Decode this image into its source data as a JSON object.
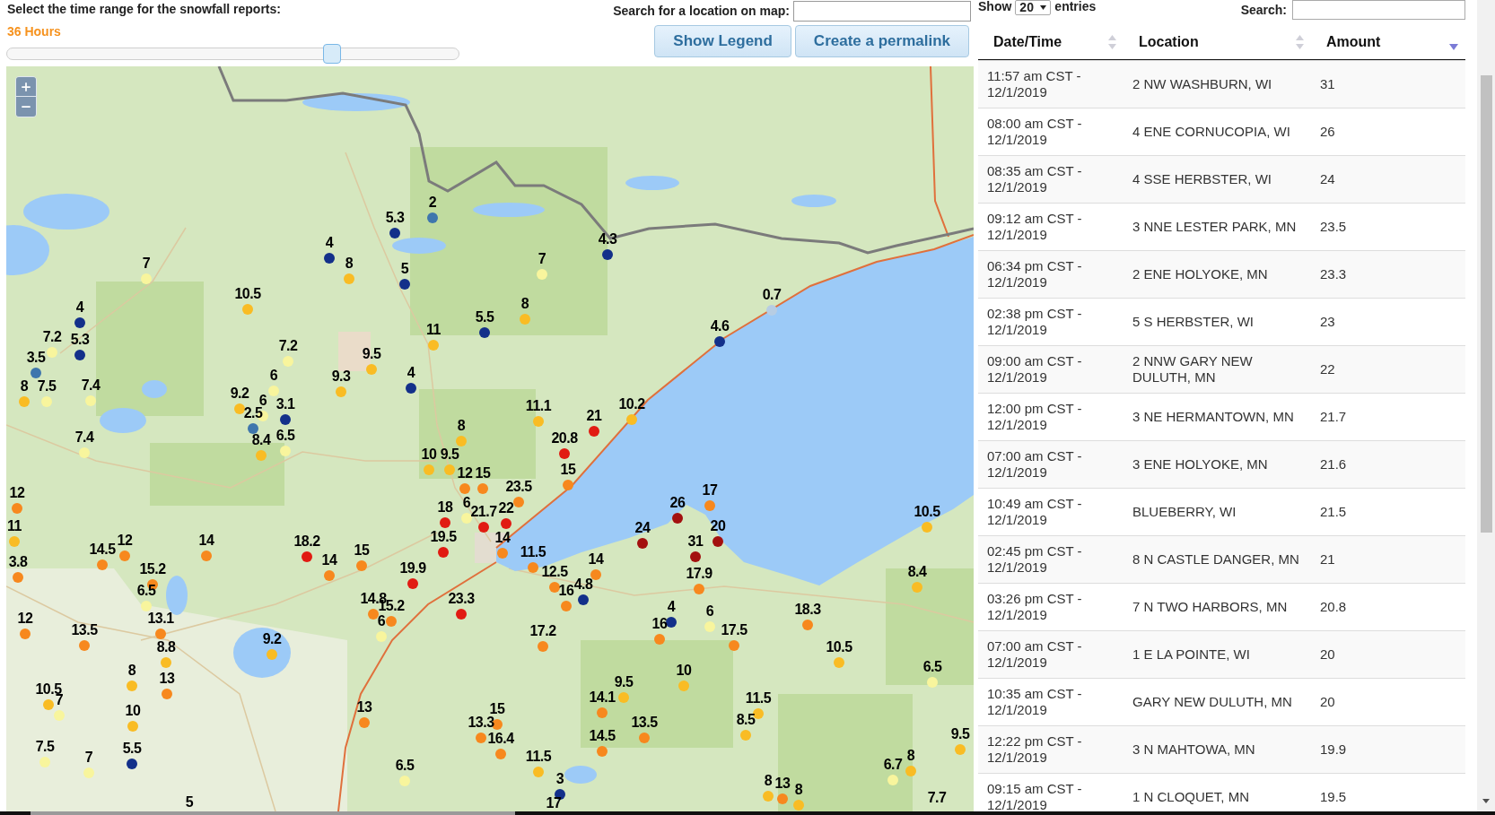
{
  "time_range": {
    "label": "Select the time range for the snowfall reports:",
    "value": "36 Hours",
    "level": 0.72
  },
  "map_search": {
    "label": "Search for a location on map:"
  },
  "buttons": [
    {
      "label": "Show Legend"
    },
    {
      "label": "Create a permalink"
    }
  ],
  "map": {
    "markers": [
      {
        "value": "2",
        "color": "#3f76ad"
      },
      {
        "value": "5.3",
        "color": "#13308a"
      },
      {
        "value": "4",
        "color": "#13308a"
      },
      {
        "value": "4.3",
        "color": "#13308a"
      },
      {
        "value": "7",
        "color": "#f8f59d"
      },
      {
        "value": "8",
        "color": "#f9bc24"
      },
      {
        "value": "5",
        "color": "#13308a"
      },
      {
        "value": "7",
        "color": "#f8f59d"
      },
      {
        "value": "10.5",
        "color": "#f9bc24"
      },
      {
        "value": "0.7",
        "color": "#b7cde3"
      },
      {
        "value": "4",
        "color": "#13308a"
      },
      {
        "value": "8",
        "color": "#f9bc24"
      },
      {
        "value": "5.5",
        "color": "#13308a"
      },
      {
        "value": "11",
        "color": "#f9bc24"
      },
      {
        "value": "4.6",
        "color": "#13308a"
      },
      {
        "value": "7.2",
        "color": "#f8f59d"
      },
      {
        "value": "5.3",
        "color": "#13308a"
      },
      {
        "value": "7.2",
        "color": "#f8f59d"
      },
      {
        "value": "3.5",
        "color": "#3f76ad"
      },
      {
        "value": "9.5",
        "color": "#f9bc24"
      },
      {
        "value": "6",
        "color": "#f8f59d"
      },
      {
        "value": "9.3",
        "color": "#f9bc24"
      },
      {
        "value": "4",
        "color": "#13308a"
      },
      {
        "value": "8",
        "color": "#f9bc24"
      },
      {
        "value": "7.5",
        "color": "#f8f59d"
      },
      {
        "value": "7.4",
        "color": "#f8f59d"
      },
      {
        "value": "9.2",
        "color": "#f9bc24"
      },
      {
        "value": "6",
        "color": "#f8f59d"
      },
      {
        "value": "3.1",
        "color": "#13308a"
      },
      {
        "value": "11.1",
        "color": "#f9bc24"
      },
      {
        "value": "10.2",
        "color": "#f9bc24"
      },
      {
        "value": "2.5",
        "color": "#3f76ad"
      },
      {
        "value": "21",
        "color": "#e11b12"
      },
      {
        "value": "8",
        "color": "#f9bc24"
      },
      {
        "value": "7.4",
        "color": "#f8f59d"
      },
      {
        "value": "8.4",
        "color": "#f9bc24"
      },
      {
        "value": "6.5",
        "color": "#f8f59d"
      },
      {
        "value": "20.8",
        "color": "#e11b12"
      },
      {
        "value": "10",
        "color": "#f9bc24"
      },
      {
        "value": "9.5",
        "color": "#f9bc24"
      },
      {
        "value": "12",
        "color": "#f7881e"
      },
      {
        "value": "15",
        "color": "#f7881e"
      },
      {
        "value": "15",
        "color": "#f7881e"
      },
      {
        "value": "12",
        "color": "#f7881e"
      },
      {
        "value": "23.5",
        "color": "#f7881e"
      },
      {
        "value": "17",
        "color": "#f7881e"
      },
      {
        "value": "18",
        "color": "#e11b12"
      },
      {
        "value": "6",
        "color": "#f8f59d"
      },
      {
        "value": "21.7",
        "color": "#e11b12"
      },
      {
        "value": "22",
        "color": "#e11b12"
      },
      {
        "value": "26",
        "color": "#a3100f"
      },
      {
        "value": "10.5",
        "color": "#f9bc24"
      },
      {
        "value": "11",
        "color": "#f9bc24"
      },
      {
        "value": "24",
        "color": "#a3100f"
      },
      {
        "value": "20",
        "color": "#a3100f"
      },
      {
        "value": "12",
        "color": "#f7881e"
      },
      {
        "value": "14",
        "color": "#f7881e"
      },
      {
        "value": "18.2",
        "color": "#e11b12"
      },
      {
        "value": "19.5",
        "color": "#e11b12"
      },
      {
        "value": "14",
        "color": "#f7881e"
      },
      {
        "value": "31",
        "color": "#a3100f"
      },
      {
        "value": "14.5",
        "color": "#f7881e"
      },
      {
        "value": "15",
        "color": "#f7881e"
      },
      {
        "value": "11.5",
        "color": "#f7881e"
      },
      {
        "value": "3.8",
        "color": "#f7881e"
      },
      {
        "value": "14",
        "color": "#f7881e"
      },
      {
        "value": "14",
        "color": "#f7881e"
      },
      {
        "value": "15.2",
        "color": "#f7881e"
      },
      {
        "value": "19.9",
        "color": "#e11b12"
      },
      {
        "value": "12.5",
        "color": "#f7881e"
      },
      {
        "value": "17.9",
        "color": "#f7881e"
      },
      {
        "value": "8.4",
        "color": "#f9bc24"
      },
      {
        "value": "4.8",
        "color": "#13308a"
      },
      {
        "value": "6.5",
        "color": "#f8f59d"
      },
      {
        "value": "16",
        "color": "#f7881e"
      },
      {
        "value": "14.8",
        "color": "#f7881e"
      },
      {
        "value": "23.3",
        "color": "#e11b12"
      },
      {
        "value": "15.2",
        "color": "#f7881e"
      },
      {
        "value": "4",
        "color": "#13308a"
      },
      {
        "value": "6",
        "color": "#f8f59d"
      },
      {
        "value": "18.3",
        "color": "#f7881e"
      },
      {
        "value": "12",
        "color": "#f7881e"
      },
      {
        "value": "13.1",
        "color": "#f7881e"
      },
      {
        "value": "6",
        "color": "#f8f59d"
      },
      {
        "value": "16",
        "color": "#f7881e"
      },
      {
        "value": "13.5",
        "color": "#f7881e"
      },
      {
        "value": "17.2",
        "color": "#f7881e"
      },
      {
        "value": "17.5",
        "color": "#f7881e"
      },
      {
        "value": "9.2",
        "color": "#f9bc24"
      },
      {
        "value": "8.8",
        "color": "#f9bc24"
      },
      {
        "value": "10.5",
        "color": "#f9bc24"
      },
      {
        "value": "8",
        "color": "#f9bc24"
      },
      {
        "value": "10",
        "color": "#f9bc24"
      },
      {
        "value": "6.5",
        "color": "#f8f59d"
      },
      {
        "value": "13",
        "color": "#f7881e"
      },
      {
        "value": "9.5",
        "color": "#f9bc24"
      },
      {
        "value": "10.5",
        "color": "#f9bc24"
      },
      {
        "value": "7",
        "color": "#f8f59d"
      },
      {
        "value": "14.1",
        "color": "#f7881e"
      },
      {
        "value": "11.5",
        "color": "#f9bc24"
      },
      {
        "value": "10",
        "color": "#f9bc24"
      },
      {
        "value": "13",
        "color": "#f7881e"
      },
      {
        "value": "15",
        "color": "#f7881e"
      },
      {
        "value": "13.3",
        "color": "#f7881e"
      },
      {
        "value": "13.5",
        "color": "#f7881e"
      },
      {
        "value": "8.5",
        "color": "#f9bc24"
      },
      {
        "value": "16.4",
        "color": "#f7881e"
      },
      {
        "value": "14.5",
        "color": "#f7881e"
      },
      {
        "value": "9.5",
        "color": "#f9bc24"
      },
      {
        "value": "7.5",
        "color": "#f8f59d"
      },
      {
        "value": "5.5",
        "color": "#13308a"
      },
      {
        "value": "7",
        "color": "#f8f59d"
      },
      {
        "value": "11.5",
        "color": "#f9bc24"
      },
      {
        "value": "8",
        "color": "#f9bc24"
      },
      {
        "value": "6.5",
        "color": "#f8f59d"
      },
      {
        "value": "6.7",
        "color": "#f8f59d"
      },
      {
        "value": "3",
        "color": "#13308a"
      },
      {
        "value": "8",
        "color": "#f9bc24"
      },
      {
        "value": "13",
        "color": "#f7881e"
      },
      {
        "value": "8",
        "color": "#f9bc24"
      },
      {
        "value": "5"
      },
      {
        "value": "17"
      },
      {
        "value": "7.7"
      }
    ]
  },
  "table": {
    "length_menu": {
      "label_before": "Show",
      "value": "20",
      "label_after": "entries"
    },
    "search": {
      "label": "Search:"
    },
    "columns": [
      {
        "label": "Date/Time",
        "sorted": false
      },
      {
        "label": "Location",
        "sorted": false
      },
      {
        "label": "Amount",
        "sorted": true
      }
    ],
    "rows": [
      {
        "date_time": "11:57 am CST - 12/1/2019",
        "location": "2 NW WASHBURN, WI",
        "amount": "31"
      },
      {
        "date_time": "08:00 am CST - 12/1/2019",
        "location": "4 ENE CORNUCOPIA, WI",
        "amount": "26"
      },
      {
        "date_time": "08:35 am CST - 12/1/2019",
        "location": "4 SSE HERBSTER, WI",
        "amount": "24"
      },
      {
        "date_time": "09:12 am CST - 12/1/2019",
        "location": "3 NNE LESTER PARK, MN",
        "amount": "23.5"
      },
      {
        "date_time": "06:34 pm CST - 12/1/2019",
        "location": "2 ENE HOLYOKE, MN",
        "amount": "23.3"
      },
      {
        "date_time": "02:38 pm CST - 12/1/2019",
        "location": "5 S HERBSTER, WI",
        "amount": "23"
      },
      {
        "date_time": "09:00 am CST - 12/1/2019",
        "location": "2 NNW GARY NEW DULUTH, MN",
        "amount": "22"
      },
      {
        "date_time": "12:00 pm CST - 12/1/2019",
        "location": "3 NE HERMANTOWN, MN",
        "amount": "21.7"
      },
      {
        "date_time": "07:00 am CST - 12/1/2019",
        "location": "3 ENE HOLYOKE, MN",
        "amount": "21.6"
      },
      {
        "date_time": "10:49 am CST - 12/1/2019",
        "location": "BLUEBERRY, WI",
        "amount": "21.5"
      },
      {
        "date_time": "02:45 pm CST - 12/1/2019",
        "location": "8 N CASTLE DANGER, MN",
        "amount": "21"
      },
      {
        "date_time": "03:26 pm CST - 12/1/2019",
        "location": "7 N TWO HARBORS, MN",
        "amount": "20.8"
      },
      {
        "date_time": "07:00 am CST - 12/1/2019",
        "location": "1 E LA POINTE, WI",
        "amount": "20"
      },
      {
        "date_time": "10:35 am CST - 12/1/2019",
        "location": "GARY NEW DULUTH, MN",
        "amount": "20"
      },
      {
        "date_time": "12:22 pm CST - 12/1/2019",
        "location": "3 N MAHTOWA, MN",
        "amount": "19.9"
      },
      {
        "date_time": "09:15 am CST - 12/1/2019",
        "location": "1 N CLOQUET, MN",
        "amount": "19.5"
      }
    ]
  }
}
